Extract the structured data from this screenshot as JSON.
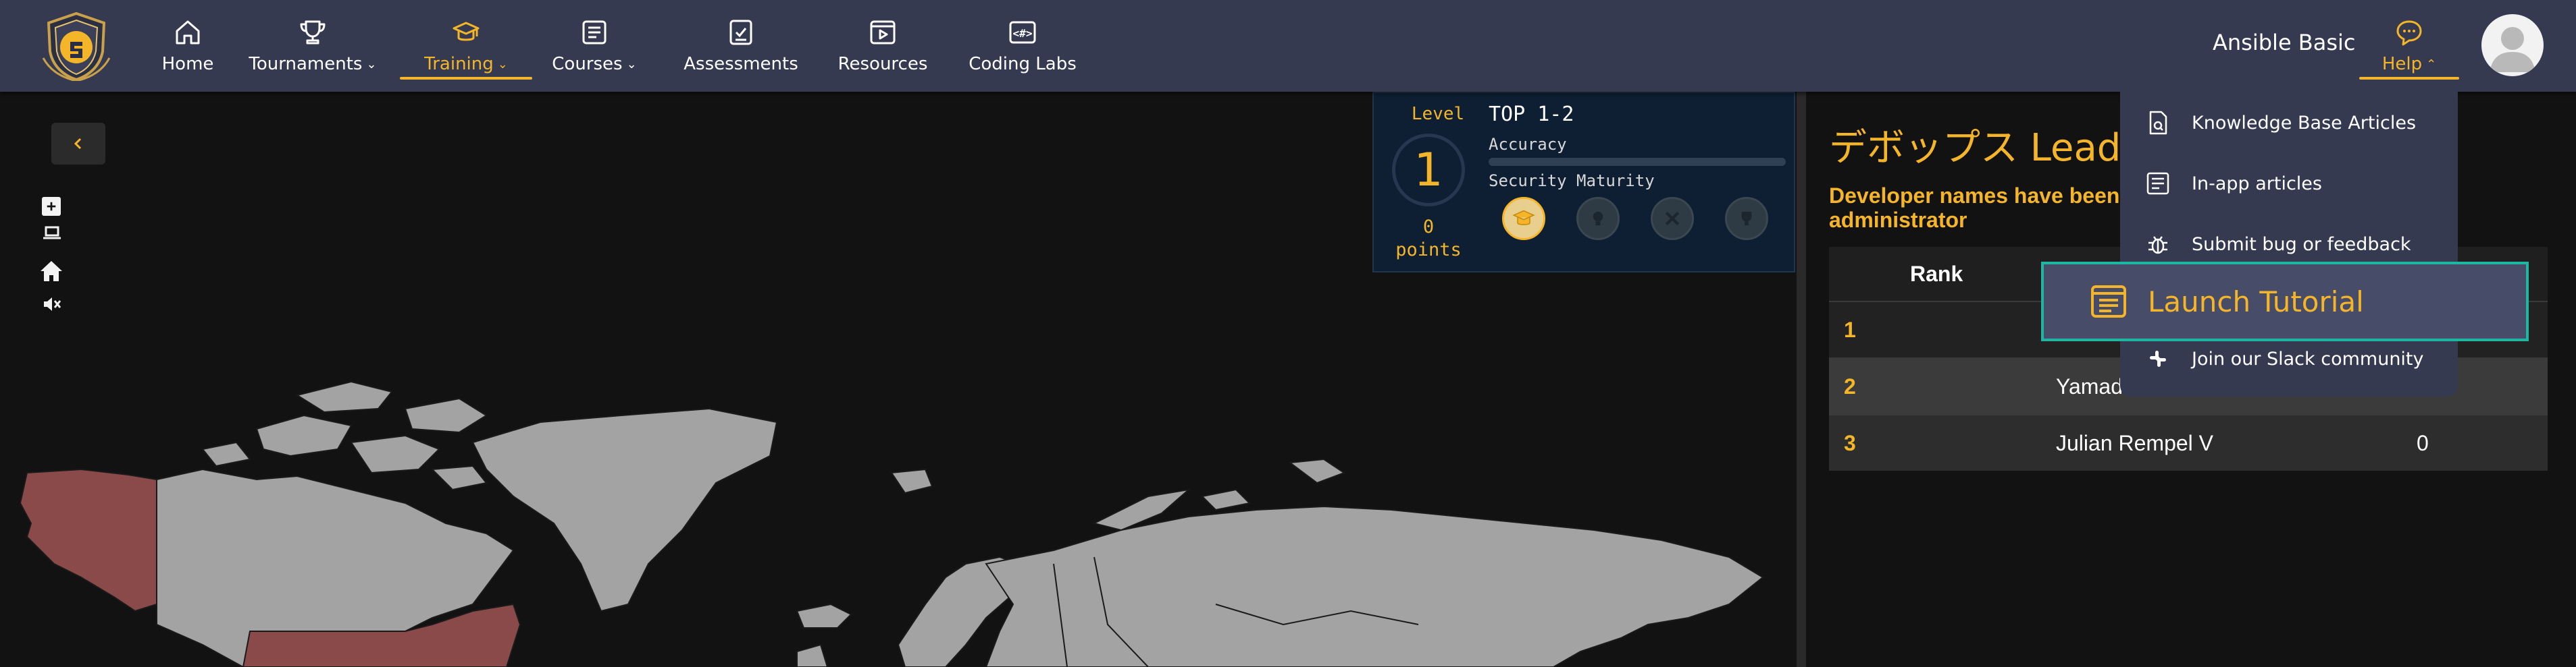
{
  "colors": {
    "nav_bg": "#353a50",
    "accent": "#f5b529",
    "map_land": "#a3a3a3",
    "map_highlight": "#8a4a4a",
    "tutorial_border": "#1fb5a3"
  },
  "nav": {
    "items": [
      {
        "label": "Home",
        "icon": "home-icon"
      },
      {
        "label": "Tournaments",
        "icon": "trophy-icon"
      },
      {
        "label": "Training",
        "icon": "graduation-cap-icon"
      },
      {
        "label": "Courses",
        "icon": "courses-icon"
      },
      {
        "label": "Assessments",
        "icon": "assessment-icon"
      },
      {
        "label": "Resources",
        "icon": "resources-icon"
      },
      {
        "label": "Coding Labs",
        "icon": "code-icon"
      }
    ],
    "active": "Training",
    "user_name": "Ansible Basic",
    "help_label": "Help"
  },
  "level_panel": {
    "level_label": "Level",
    "level": "1",
    "points": "0",
    "points_label": "points",
    "top": "TOP 1-2",
    "accuracy_label": "Accuracy",
    "accuracy_fraction": 0,
    "security_label": "Security Maturity"
  },
  "leaderboard": {
    "title": "デボップス Leade",
    "note": "Developer names have been administrator",
    "columns": [
      "Rank"
    ],
    "rows": [
      {
        "rank": "1",
        "name": "",
        "score": ""
      },
      {
        "rank": "2",
        "name": "Yamad",
        "score": ""
      },
      {
        "rank": "3",
        "name": "Julian Rempel V",
        "score": "0"
      }
    ]
  },
  "help_menu": {
    "items": [
      {
        "label": "Knowledge Base Articles",
        "icon": "knowledge-base-icon"
      },
      {
        "label": "In-app articles",
        "icon": "article-icon"
      },
      {
        "label": "Submit bug or feedback",
        "icon": "bug-icon"
      },
      {
        "label": "Join our Slack community",
        "icon": "slack-icon"
      }
    ],
    "tutorial_label": "Launch Tutorial"
  }
}
